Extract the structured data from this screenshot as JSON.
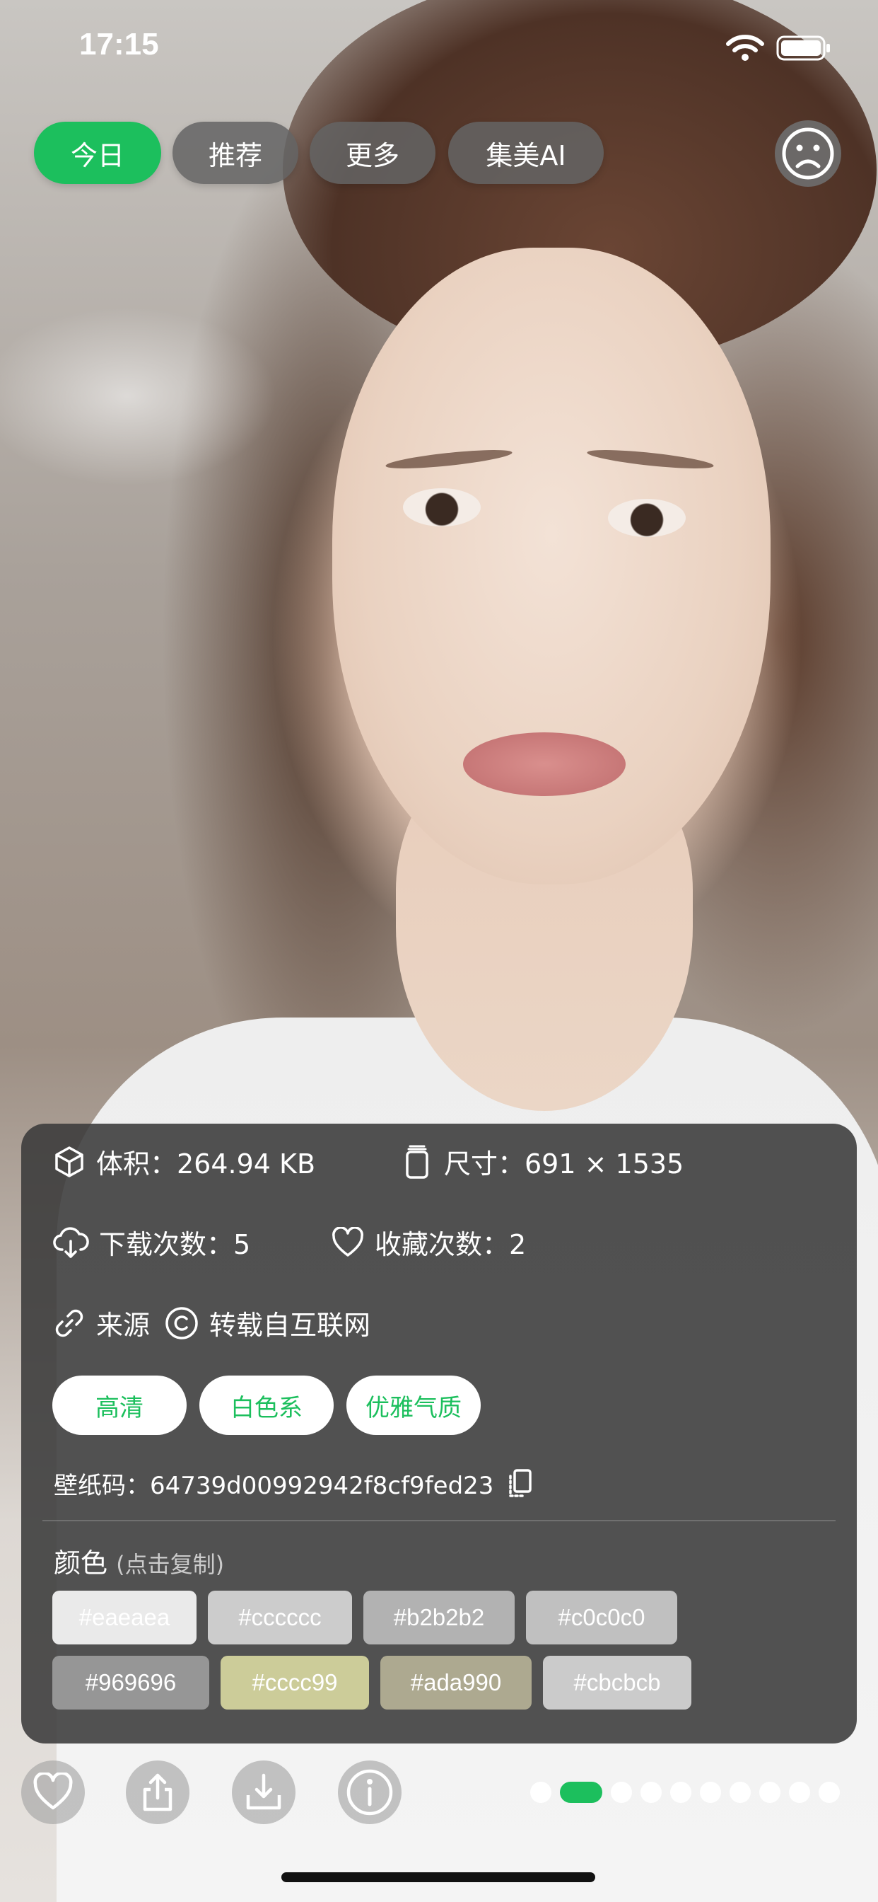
{
  "status_bar": {
    "time": "17:15"
  },
  "top_tabs": [
    {
      "label": "今日",
      "active": true
    },
    {
      "label": "推荐",
      "active": false
    },
    {
      "label": "更多",
      "active": false
    },
    {
      "label": "集美AI",
      "active": false
    }
  ],
  "info": {
    "size_label": "体积：264.94 KB",
    "dimensions_label": "尺寸：691 × 1535",
    "downloads_label": "下载次数：5",
    "favorites_label": "收藏次数：2",
    "source_label": "来源",
    "source_value": "转载自互联网",
    "tags": [
      "高清",
      "白色系",
      "优雅气质"
    ],
    "code_label": "壁纸码：64739d00992942f8cf9fed23",
    "colors_title": "颜色",
    "colors_hint": "(点击复制)",
    "colors": [
      {
        "label": "#eaeaea",
        "hex": "#eaeaea"
      },
      {
        "label": "#cccccc",
        "hex": "#cccccc"
      },
      {
        "label": "#b2b2b2",
        "hex": "#b2b2b2"
      },
      {
        "label": "#c0c0c0",
        "hex": "#c0c0c0"
      },
      {
        "label": "#969696",
        "hex": "#969696"
      },
      {
        "label": "#cccc99",
        "hex": "#cccc99"
      },
      {
        "label": "#ada990",
        "hex": "#ada990"
      },
      {
        "label": "#cbcbcb",
        "hex": "#cbcbcb"
      }
    ]
  },
  "bottom_bar": {
    "actions": [
      "heart-icon",
      "share-icon",
      "download-icon",
      "info-icon"
    ],
    "page_dots": 10,
    "active_dot": 1
  },
  "accent_color": "#1cbf5d"
}
